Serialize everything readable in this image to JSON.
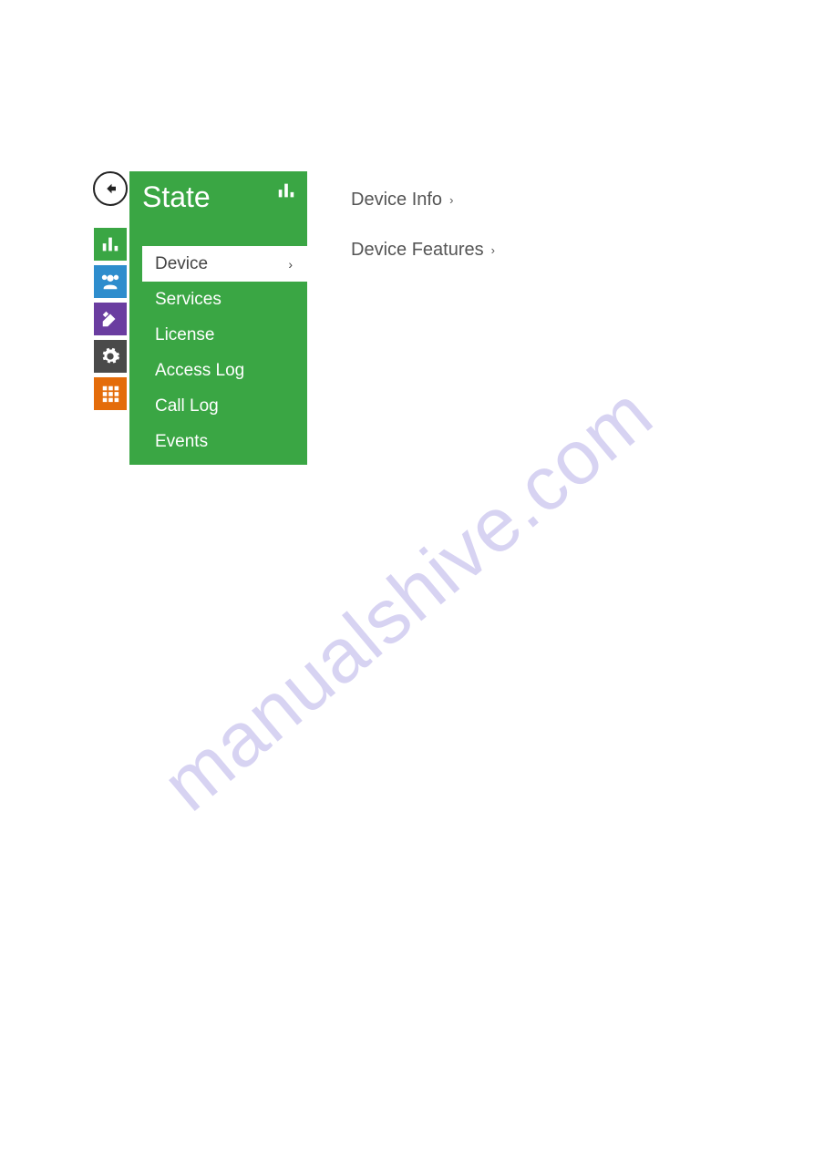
{
  "sidebar": {
    "title": "State",
    "items": [
      {
        "label": "Device",
        "active": true
      },
      {
        "label": "Services",
        "active": false
      },
      {
        "label": "License",
        "active": false
      },
      {
        "label": "Access Log",
        "active": false
      },
      {
        "label": "Call Log",
        "active": false
      },
      {
        "label": "Events",
        "active": false
      }
    ]
  },
  "content": {
    "links": [
      {
        "label": "Device Info"
      },
      {
        "label": "Device Features"
      }
    ]
  },
  "rail_icons": [
    "bar-chart-icon",
    "users-icon",
    "tools-icon",
    "gear-icon",
    "grid-icon"
  ],
  "watermark": "manualshive.com"
}
